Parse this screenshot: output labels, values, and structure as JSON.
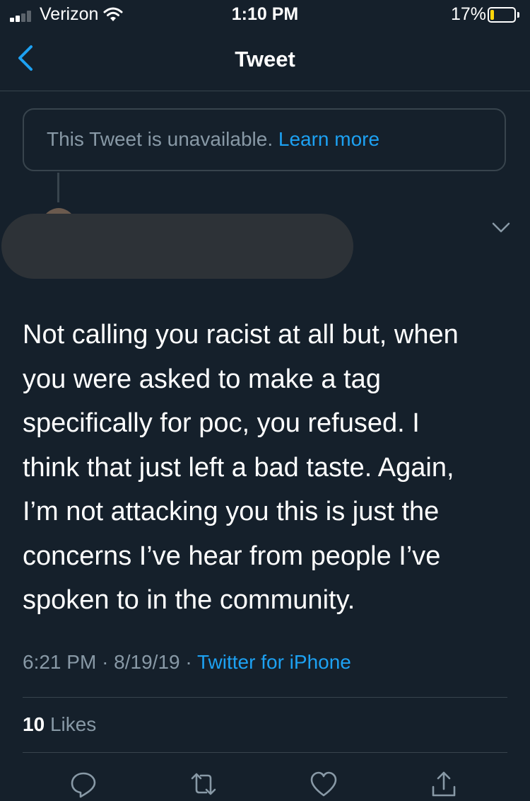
{
  "status_bar": {
    "carrier": "Verizon",
    "time": "1:10 PM",
    "battery": "17%",
    "battery_level": 0.17,
    "battery_color": "#ffd60a",
    "icons": [
      "signal-icon",
      "wifi-icon",
      "battery-icon"
    ]
  },
  "nav": {
    "title": "Tweet",
    "back_icon": "chevron-left-icon"
  },
  "unavailable": {
    "message": "This Tweet is unavailable.",
    "link": "Learn more"
  },
  "tweet": {
    "text": "Not calling you racist at all but, when\nyou were asked to make a tag\nspecifically for poc,  you refused. I\nthink that just left a bad taste. Again,\nI’m not attacking you this is just the\nconcerns I’ve hear from people I’ve\nspoken to in the community.",
    "time": "6:21 PM",
    "date": "8/19/19",
    "source": "Twitter for iPhone",
    "likes_count": "10",
    "likes_label": "Likes",
    "menu_icon": "chevron-down-icon"
  },
  "actions": [
    {
      "icon": "reply-icon"
    },
    {
      "icon": "retweet-icon"
    },
    {
      "icon": "like-icon"
    },
    {
      "icon": "share-icon"
    }
  ],
  "colors": {
    "background": "#15202b",
    "accent": "#1da1f2",
    "secondary_text": "#8899a6",
    "border": "#38444d"
  }
}
